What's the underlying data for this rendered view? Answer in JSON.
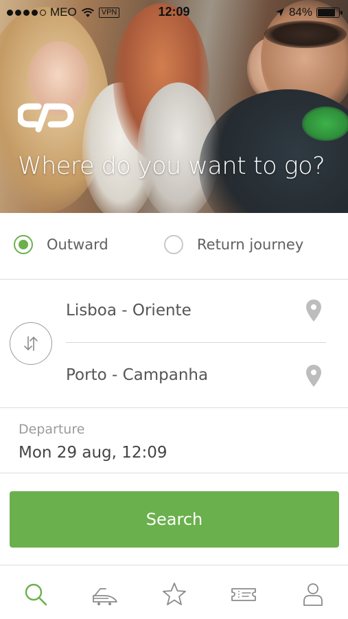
{
  "status_bar": {
    "carrier": "MEO",
    "vpn": "VPN",
    "time": "12:09",
    "battery": "84%",
    "battery_level": 0.84,
    "signal_bars_filled": 4,
    "signal_bars_total": 5
  },
  "hero": {
    "logo": "cp",
    "title": "Where do you want to go?"
  },
  "journey_type": {
    "outward_label": "Outward",
    "return_label": "Return journey",
    "selected": "outward"
  },
  "route": {
    "origin": "Lisboa - Oriente",
    "destination": "Porto - Campanha",
    "swap_icon": "swap-arrows-icon",
    "origin_icon": "location-pin-icon",
    "destination_icon": "location-pin-icon"
  },
  "departure": {
    "label": "Departure",
    "value": "Mon 29 aug, 12:09"
  },
  "search_button": {
    "label": "Search"
  },
  "tab_bar": {
    "tabs": [
      {
        "name": "search",
        "icon": "search-icon",
        "active": true
      },
      {
        "name": "trains",
        "icon": "train-icon",
        "active": false
      },
      {
        "name": "favorites",
        "icon": "star-icon",
        "active": false
      },
      {
        "name": "tickets",
        "icon": "ticket-icon",
        "active": false
      },
      {
        "name": "profile",
        "icon": "user-icon",
        "active": false
      }
    ]
  },
  "colors": {
    "accent": "#6ab04c",
    "text": "#555555",
    "muted": "#9a9a9a",
    "divider": "#dcdcdc",
    "icon_inactive": "#8a8a8a"
  }
}
